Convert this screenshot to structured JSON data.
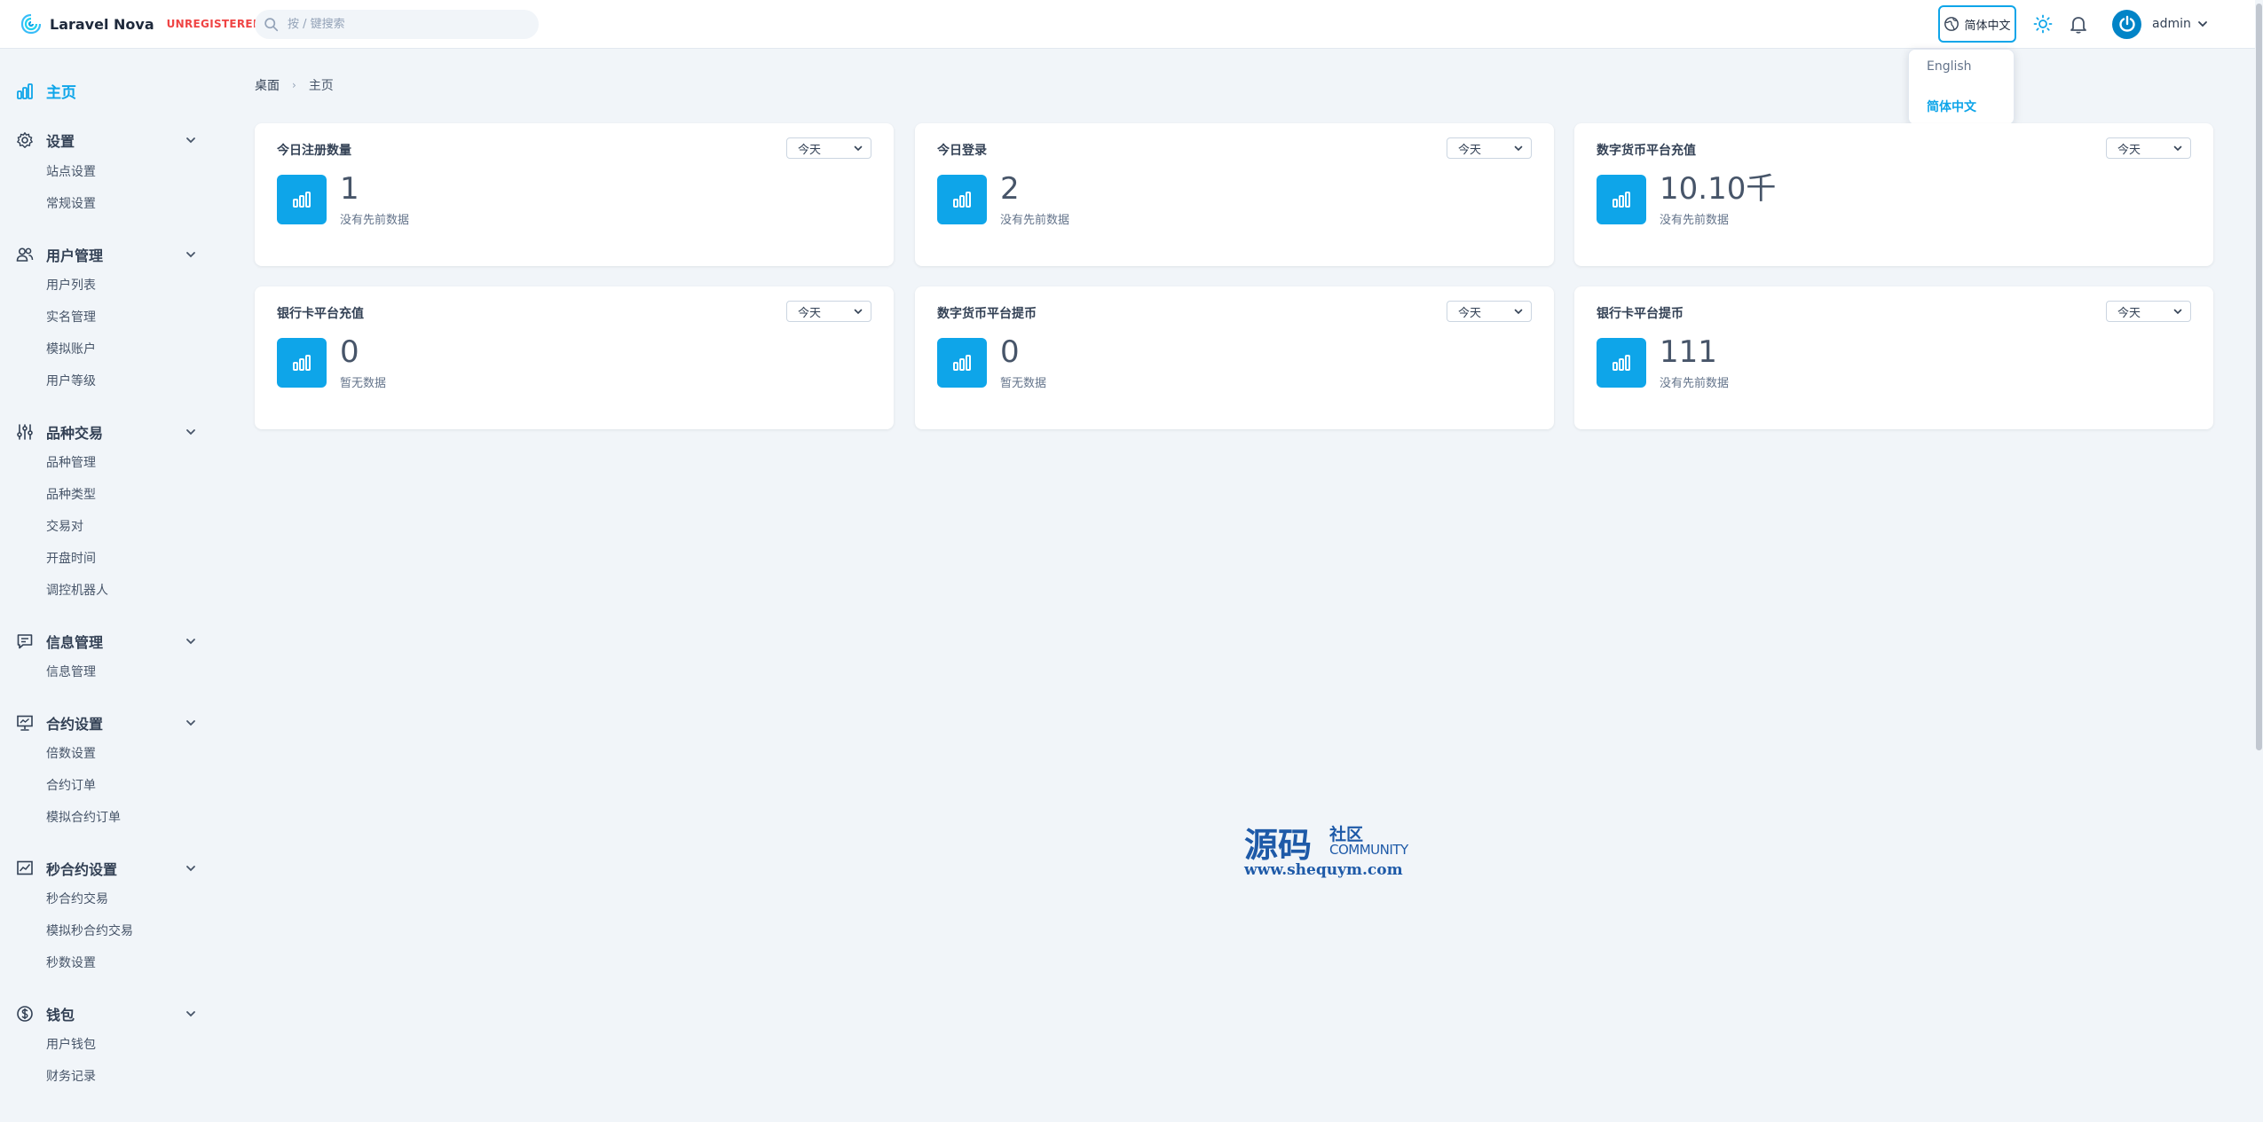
{
  "header": {
    "app_name": "Laravel Nova",
    "license_badge": "UNREGISTERED",
    "search_placeholder": "按 / 键搜索",
    "language_button": "简体中文",
    "user_name": "admin"
  },
  "language_menu": {
    "options": [
      "English",
      "简体中文"
    ],
    "selected": "简体中文"
  },
  "sidebar": {
    "home": "主页",
    "groups": [
      {
        "label": "设置",
        "icon": "gear-icon",
        "items": [
          "站点设置",
          "常规设置"
        ]
      },
      {
        "label": "用户管理",
        "icon": "users-icon",
        "items": [
          "用户列表",
          "实名管理",
          "模拟账户",
          "用户等级"
        ]
      },
      {
        "label": "品种交易",
        "icon": "sliders-icon",
        "items": [
          "品种管理",
          "品种类型",
          "交易对",
          "开盘时间",
          "调控机器人"
        ]
      },
      {
        "label": "信息管理",
        "icon": "message-icon",
        "items": [
          "信息管理"
        ]
      },
      {
        "label": "合约设置",
        "icon": "presentation-icon",
        "items": [
          "倍数设置",
          "合约订单",
          "模拟合约订单"
        ]
      },
      {
        "label": "秒合约设置",
        "icon": "trend-chart-icon",
        "items": [
          "秒合约交易",
          "模拟秒合约交易",
          "秒数设置"
        ]
      },
      {
        "label": "钱包",
        "icon": "dollar-icon",
        "items": [
          "用户钱包",
          "财务记录"
        ]
      }
    ]
  },
  "breadcrumb": {
    "root": "桌面",
    "current": "主页"
  },
  "cards": [
    {
      "title": "今日注册数量",
      "range": "今天",
      "value": "1",
      "subtitle": "没有先前数据"
    },
    {
      "title": "今日登录",
      "range": "今天",
      "value": "2",
      "subtitle": "没有先前数据"
    },
    {
      "title": "数字货币平台充值",
      "range": "今天",
      "value": "10.10千",
      "subtitle": "没有先前数据"
    },
    {
      "title": "银行卡平台充值",
      "range": "今天",
      "value": "0",
      "subtitle": "暂无数据"
    },
    {
      "title": "数字货币平台提币",
      "range": "今天",
      "value": "0",
      "subtitle": "暂无数据"
    },
    {
      "title": "银行卡平台提币",
      "range": "今天",
      "value": "111",
      "subtitle": "没有先前数据"
    }
  ],
  "watermark": {
    "chinese": "源码",
    "sub_chinese": "社区",
    "english": "COMMUNITY",
    "url": "www.shequym.com"
  },
  "colors": {
    "accent": "#0ea5e9",
    "danger": "#ef4444",
    "background": "#f1f5f9",
    "watermark": "#1e5aa8"
  }
}
